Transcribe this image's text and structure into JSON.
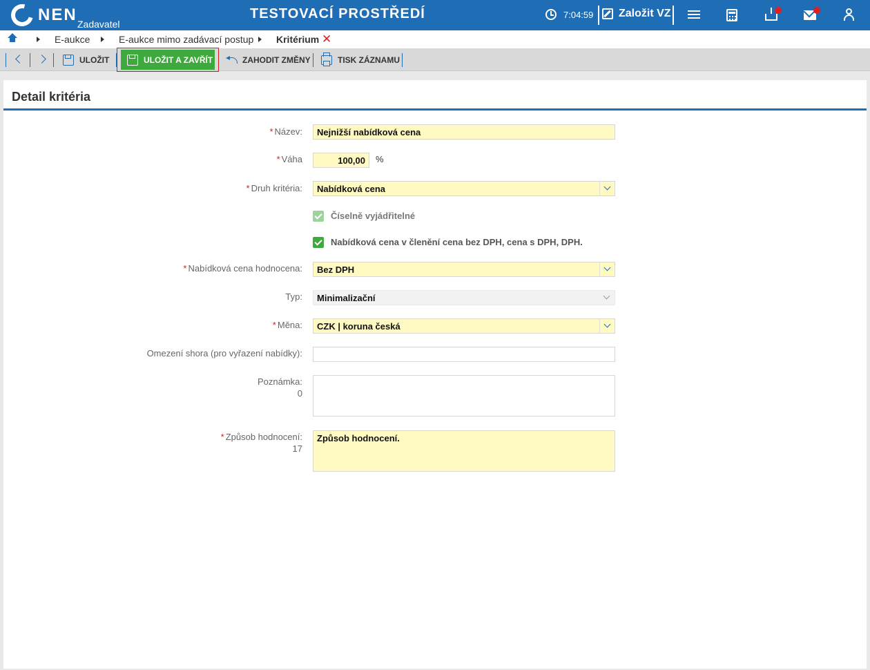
{
  "header": {
    "logo": "NEN",
    "logo_sub": "Zadavatel",
    "env_title": "TESTOVACÍ PROSTŘEDÍ",
    "clock": "7:04:59",
    "create_label": "Založit VZ"
  },
  "breadcrumb": {
    "items": [
      "E-aukce",
      "E-aukce mimo zadávací postup",
      "Kritérium"
    ],
    "close": "✕"
  },
  "toolbar": {
    "save": "ULOŽIT",
    "save_close": "ULOŽIT A ZAVŘÍT",
    "discard": "ZAHODIT ZMĚNY",
    "print": "TISK ZÁZNAMU"
  },
  "panel": {
    "title": "Detail kritéria"
  },
  "form": {
    "nazev": {
      "label": "Název:",
      "value": "Nejnižší nabídková cena"
    },
    "vaha": {
      "label": "Váha",
      "value": "100,00",
      "unit": "%"
    },
    "druh": {
      "label": "Druh kritéria:",
      "value": "Nabídková cena"
    },
    "ciselne": {
      "label": "Číselně vyjádřitelné",
      "checked": true,
      "disabled": true
    },
    "cleneni": {
      "label": "Nabídková cena v členění cena bez DPH, cena s DPH, DPH.",
      "checked": true
    },
    "hodnocena": {
      "label": "Nabídková cena hodnocena:",
      "value": "Bez DPH"
    },
    "typ": {
      "label": "Typ:",
      "value": "Minimalizační"
    },
    "mena": {
      "label": "Měna:",
      "value": "CZK | koruna česká"
    },
    "omezeni": {
      "label": "Omezení shora (pro vyřazení nabídky):",
      "value": ""
    },
    "poznamka": {
      "label": "Poznámka:",
      "count": "0",
      "value": ""
    },
    "zpusob": {
      "label": "Způsob hodnocení:",
      "count": "17",
      "value": "Způsob hodnocení."
    }
  },
  "required_mark": "*",
  "colors": {
    "brand": "#1f6db5",
    "accent_green": "#3ea93c",
    "required": "#cf2020",
    "field_required_bg": "#fff9c2"
  }
}
